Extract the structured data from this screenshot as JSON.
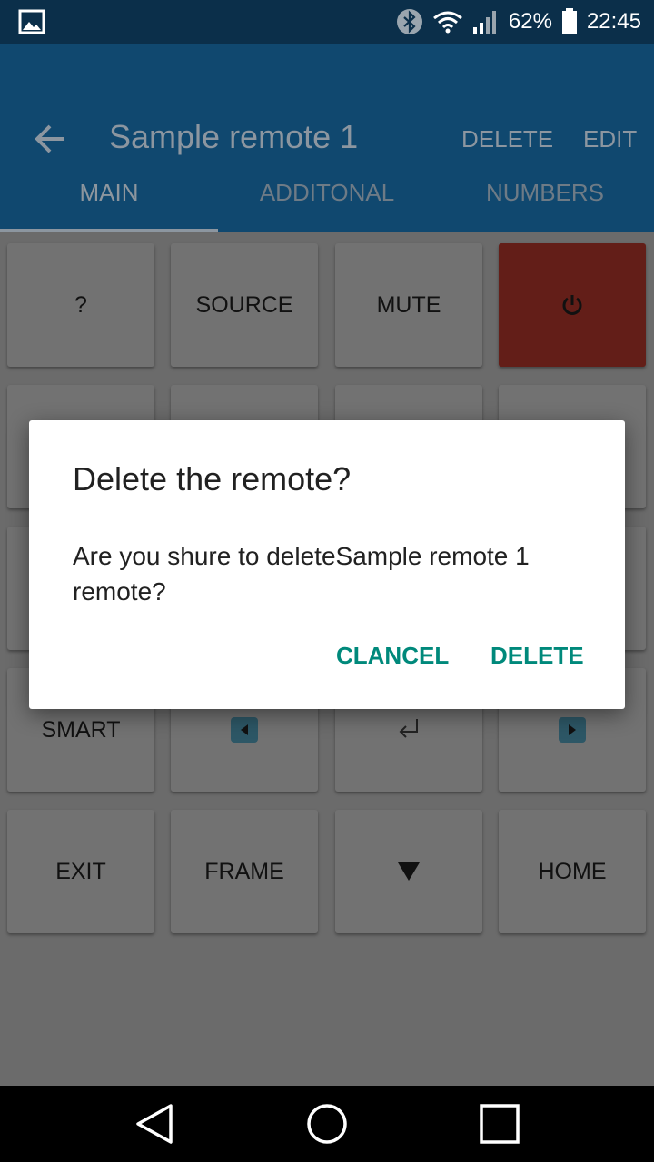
{
  "status": {
    "battery_pct": "62%",
    "time": "22:45"
  },
  "app_bar": {
    "title": "Sample remote 1",
    "delete_label": "DELETE",
    "edit_label": "EDIT"
  },
  "tabs": [
    {
      "label": "MAIN"
    },
    {
      "label": "ADDITONAL"
    },
    {
      "label": "NUMBERS"
    }
  ],
  "keys": {
    "help": "?",
    "source": "SOURCE",
    "mute": "MUTE",
    "smart": "SMART",
    "exit": "EXIT",
    "frame": "FRAME",
    "home": "HOME"
  },
  "dialog": {
    "title": "Delete the remote?",
    "message": "Are you shure to deleteSample remote 1 remote?",
    "cancel_label": "CLANCEL",
    "confirm_label": "DELETE"
  },
  "colors": {
    "accent": "#00897b",
    "app_bar": "#10486f",
    "status_bar": "#0b2f4a",
    "power_key": "#631e18"
  },
  "icons": [
    "gallery-icon",
    "bluetooth-icon",
    "wifi-icon",
    "signal-icon",
    "battery-icon",
    "back-arrow-icon",
    "power-icon",
    "left-arrow-icon",
    "enter-icon",
    "right-arrow-icon",
    "down-triangle-icon",
    "nav-back-icon",
    "nav-home-icon",
    "nav-recents-icon"
  ]
}
